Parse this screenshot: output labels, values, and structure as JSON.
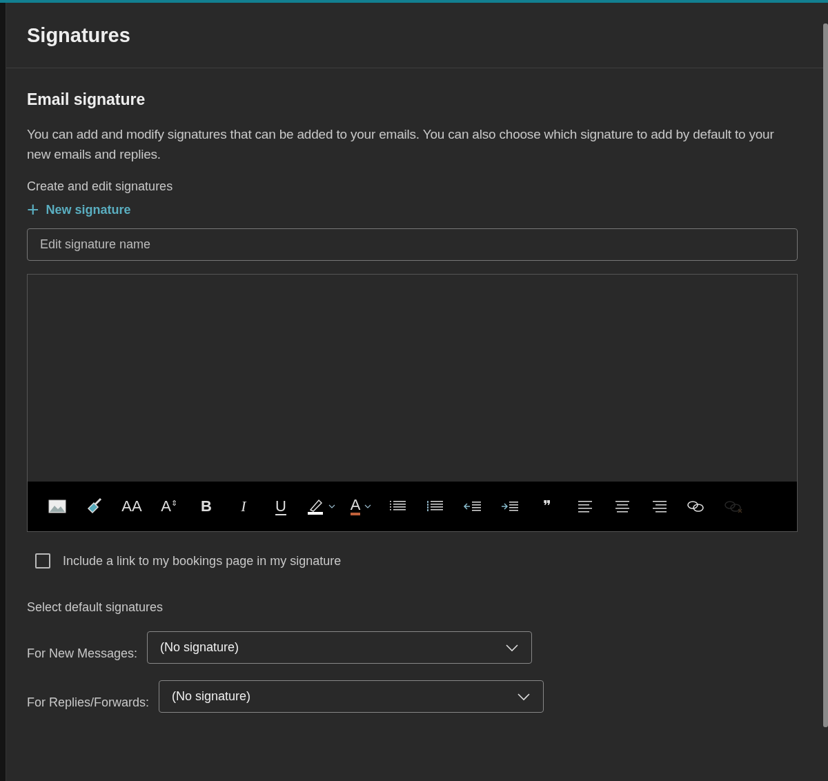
{
  "panel": {
    "title": "Signatures"
  },
  "section": {
    "title": "Email signature",
    "description": "You can add and modify signatures that can be added to your emails. You can also choose which signature to add by default to your new emails and replies.",
    "create_label": "Create and edit signatures",
    "new_link": {
      "label": "New signature",
      "plus": "+"
    },
    "name_field": {
      "placeholder": "Edit signature name"
    },
    "toolbar": [
      {
        "kind": "image",
        "disabled": false,
        "menu": false
      },
      {
        "kind": "paint",
        "disabled": false,
        "menu": false
      },
      {
        "kind": "font",
        "glyph": "AA",
        "disabled": false,
        "menu": false
      },
      {
        "kind": "size",
        "glyph": "A",
        "sup": "⇕",
        "disabled": false,
        "menu": false
      },
      {
        "kind": "bold",
        "glyph": "B",
        "disabled": false,
        "menu": false
      },
      {
        "kind": "italic",
        "glyph": "I",
        "disabled": false,
        "menu": false
      },
      {
        "kind": "underline",
        "glyph": "U",
        "disabled": false,
        "menu": false
      },
      {
        "kind": "highlight",
        "disabled": false,
        "menu": true
      },
      {
        "kind": "font-color",
        "glyph": "A",
        "disabled": false,
        "menu": true
      },
      {
        "kind": "bullets",
        "disabled": false,
        "menu": false
      },
      {
        "kind": "numbers",
        "disabled": false,
        "menu": false
      },
      {
        "kind": "outdent",
        "disabled": false,
        "menu": false
      },
      {
        "kind": "indent",
        "disabled": false,
        "menu": false
      },
      {
        "kind": "quote",
        "glyph": "❞",
        "disabled": false,
        "menu": false
      },
      {
        "kind": "align-left",
        "disabled": false,
        "menu": false
      },
      {
        "kind": "align-center",
        "disabled": false,
        "menu": false
      },
      {
        "kind": "align-right",
        "disabled": false,
        "menu": false
      },
      {
        "kind": "link",
        "disabled": false,
        "menu": false
      },
      {
        "kind": "unlink",
        "disabled": true,
        "menu": false
      }
    ],
    "bookings_checkbox": {
      "label": "Include a link to my bookings page in my signature",
      "checked": false
    },
    "defaults_label": "Select default signatures",
    "defaults": [
      {
        "label": "For New Messages:",
        "value": "(No signature)"
      },
      {
        "label": "For Replies/Forwards:",
        "value": "(No signature)"
      }
    ]
  }
}
